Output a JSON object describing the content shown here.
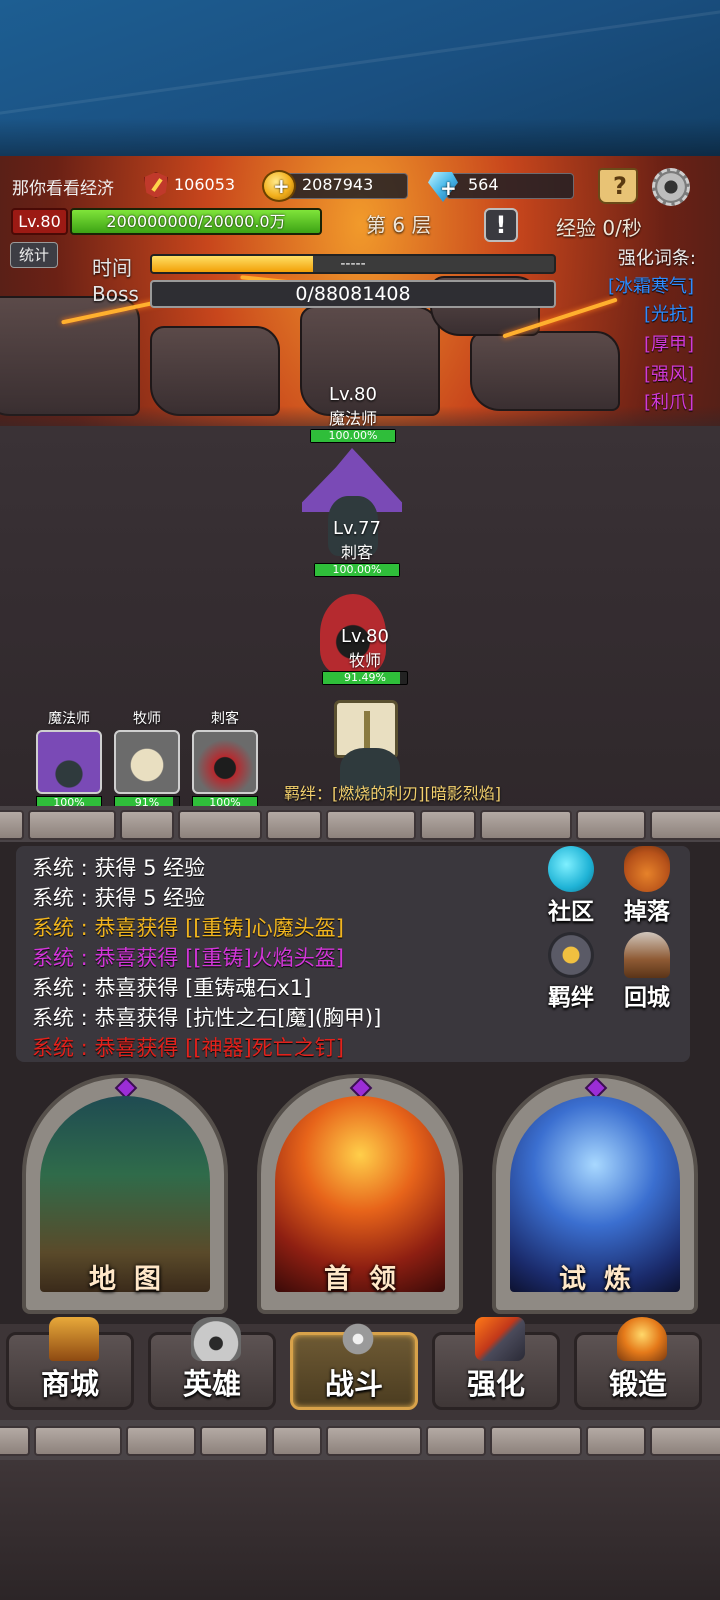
{
  "player": {
    "name": "那你看看经济",
    "power": "106053",
    "gold": "2087943",
    "diamonds": "564",
    "level_badge": "Lv.80",
    "exp_text": "200000000/20000.0万",
    "exp_progress": 1.0
  },
  "stage": {
    "floor_label": "第 6 层",
    "exp_rate": "经验 0/秒",
    "stat_button": "统计",
    "time_label": "时间",
    "time_text": "-----",
    "time_progress": 0.4,
    "boss_label": "Boss",
    "boss_hp_text": "0/88081408"
  },
  "buffs": {
    "title": "强化词条:",
    "items": [
      {
        "label": "[冰霜寒气]",
        "color": "#2d8cff"
      },
      {
        "label": "[光抗]",
        "color": "#2d8cff"
      },
      {
        "label": "[厚甲]",
        "color": "#d13ad8"
      },
      {
        "label": "[强风]",
        "color": "#d13ad8"
      },
      {
        "label": "[利爪]",
        "color": "#d13ad8"
      }
    ]
  },
  "battle_units": [
    {
      "level": "Lv.80",
      "name": "魔法师",
      "hp_text": "100.00%",
      "hp": 1.0
    },
    {
      "level": "Lv.77",
      "name": "刺客",
      "hp_text": "100.00%",
      "hp": 1.0
    },
    {
      "level": "Lv.80",
      "name": "牧师",
      "hp_text": "91.49%",
      "hp": 0.9149
    }
  ],
  "bond_text": "羁绊：[燃烧的利刃][暗影烈焰]",
  "party": [
    {
      "name": "魔法师",
      "hp_text": "100%",
      "hp": 1.0
    },
    {
      "name": "牧师",
      "hp_text": "91%",
      "hp": 0.91
    },
    {
      "name": "刺客",
      "hp_text": "100%",
      "hp": 1.0
    }
  ],
  "log": [
    {
      "prefix": "系统 : ",
      "text": "获得 5 经验",
      "color": "#ffffff"
    },
    {
      "prefix": "系统 : ",
      "text": "获得 5 经验",
      "color": "#ffffff"
    },
    {
      "prefix": "系统 : ",
      "text": "恭喜获得 [[重铸]心魔头盔]",
      "color": "#f1b51f"
    },
    {
      "prefix": "系统 : ",
      "text": "恭喜获得 [[重铸]火焰头盔]",
      "color": "#d336d9"
    },
    {
      "prefix": "系统 : ",
      "text": "恭喜获得 [重铸魂石x1]",
      "color": "#ffffff"
    },
    {
      "prefix": "系统 : ",
      "text": "恭喜获得 [抗性之石[魔](胸甲)]",
      "color": "#ffffff"
    },
    {
      "prefix": "系统 : ",
      "text": "恭喜获得 [[神器]死亡之钉]",
      "color": "#e3221c"
    }
  ],
  "side_buttons": {
    "community": "社区",
    "drops": "掉落",
    "bonds": "羁绊",
    "return_city": "回城"
  },
  "cards": {
    "map": "地图",
    "boss": "首领",
    "trial": "试炼"
  },
  "nav": {
    "shop": "商城",
    "heroes": "英雄",
    "battle": "战斗",
    "enhance": "强化",
    "forge": "锻造"
  },
  "icons": {
    "power": "sword-shield-icon",
    "gold": "gold-coin-icon",
    "diamond": "diamond-icon",
    "help": "help-book-icon",
    "settings": "gear-icon"
  }
}
